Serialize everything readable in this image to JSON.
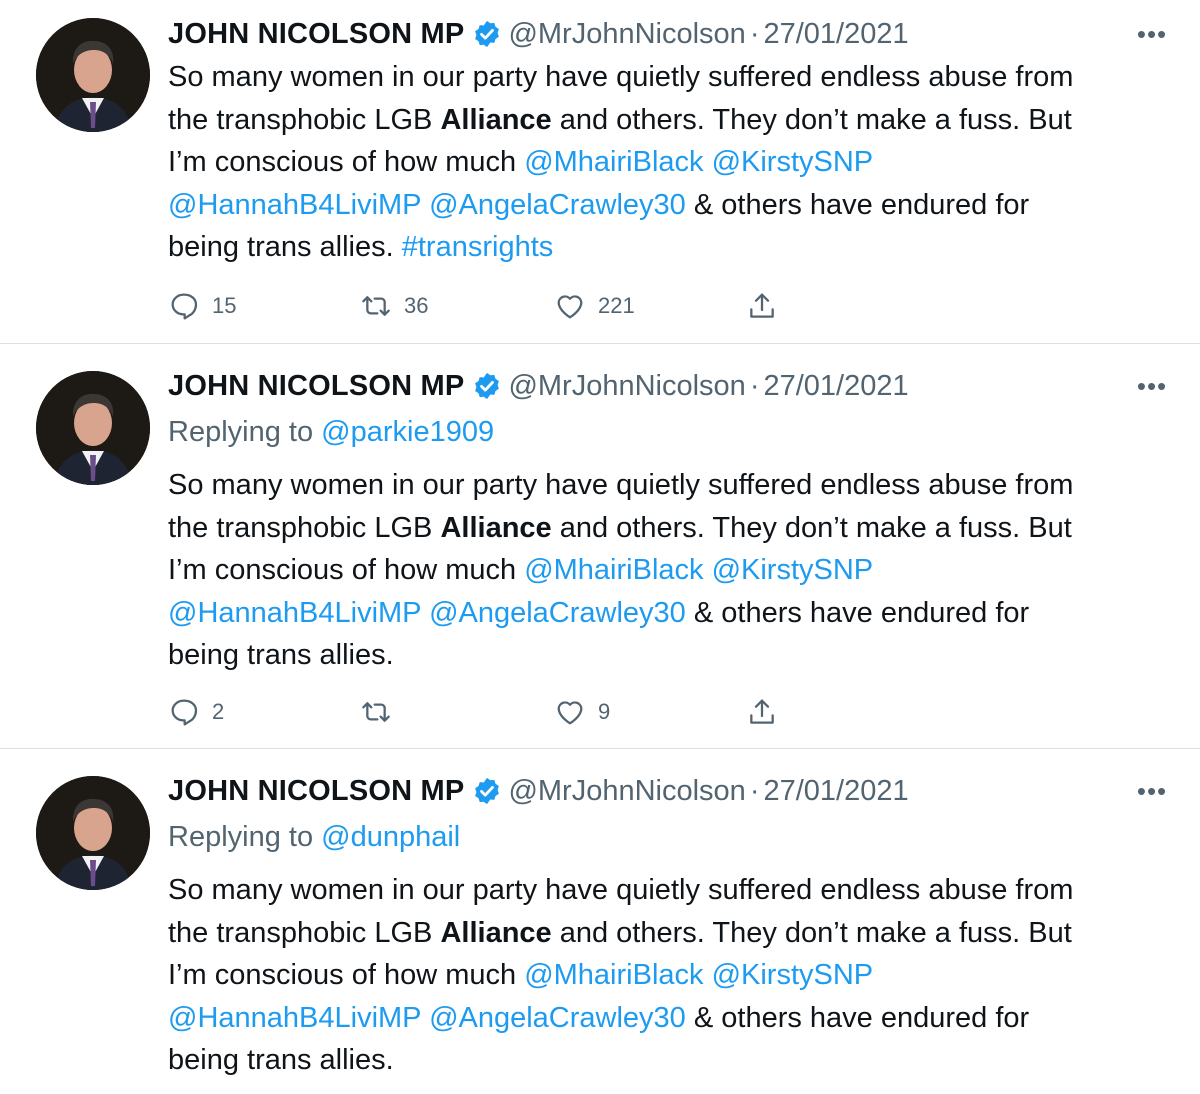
{
  "tweets": [
    {
      "author_name": "JOHN NICOLSON MP",
      "handle": "@MrJohnNicolson",
      "separator": "·",
      "date": "27/01/2021",
      "more_label": "•••",
      "replying_prefix": "",
      "replying_handle": "",
      "body": {
        "l1": "So many women in our party have quietly suffered endless abuse from",
        "l2a": "the transphobic LGB ",
        "l2b": "Alliance",
        "l2c": " and others. They don’t make a fuss. But",
        "l3a": "I’m conscious of how much ",
        "l3b": "@MhairiBlack",
        "l3c": " ",
        "l3d": "@KirstySNP",
        "l4a": "@HannahB4LiviMP",
        "l4b": " ",
        "l4c": "@AngelaCrawley30",
        "l4d": " & others have endured for",
        "l5a": "being trans allies. ",
        "l5b": "#transrights"
      },
      "actions": {
        "replies": "15",
        "retweets": "36",
        "likes": "221"
      }
    },
    {
      "author_name": "JOHN NICOLSON MP",
      "handle": "@MrJohnNicolson",
      "separator": "·",
      "date": "27/01/2021",
      "more_label": "•••",
      "replying_prefix": "Replying to ",
      "replying_handle": "@parkie1909",
      "body": {
        "l1": "So many women in our party have quietly suffered endless abuse from",
        "l2a": "the transphobic LGB ",
        "l2b": "Alliance",
        "l2c": " and others. They don’t make a fuss. But",
        "l3a": "I’m conscious of how much ",
        "l3b": "@MhairiBlack",
        "l3c": " ",
        "l3d": "@KirstySNP",
        "l4a": "@HannahB4LiviMP",
        "l4b": " ",
        "l4c": "@AngelaCrawley30",
        "l4d": " & others have endured for",
        "l5a": "being trans allies."
      },
      "actions": {
        "replies": "2",
        "retweets": "",
        "likes": "9"
      }
    },
    {
      "author_name": "JOHN NICOLSON MP",
      "handle": "@MrJohnNicolson",
      "separator": "·",
      "date": "27/01/2021",
      "more_label": "•••",
      "replying_prefix": "Replying to ",
      "replying_handle": "@dunphail",
      "body": {
        "l1": "So many women in our party have quietly suffered endless abuse from",
        "l2a": "the transphobic LGB ",
        "l2b": "Alliance",
        "l2c": " and others. They don’t make a fuss. But",
        "l3a": "I’m conscious of how much ",
        "l3b": "@MhairiBlack",
        "l3c": " ",
        "l3d": "@KirstySNP",
        "l4a": "@HannahB4LiviMP",
        "l4b": " ",
        "l4c": "@AngelaCrawley30",
        "l4d": " & others have endured for",
        "l5a": "being trans allies."
      }
    }
  ],
  "icons": {
    "avatar": "profile-photo",
    "verified": "verified-badge-icon",
    "reply": "speech-bubble-icon",
    "retweet": "retweet-arrows-icon",
    "like": "heart-icon",
    "share": "share-upload-icon",
    "more": "ellipsis-icon"
  },
  "colors": {
    "link": "#1d9bf0",
    "secondary_text": "#536471",
    "primary_text": "#0f1419",
    "divider": "#dcdfe3"
  }
}
